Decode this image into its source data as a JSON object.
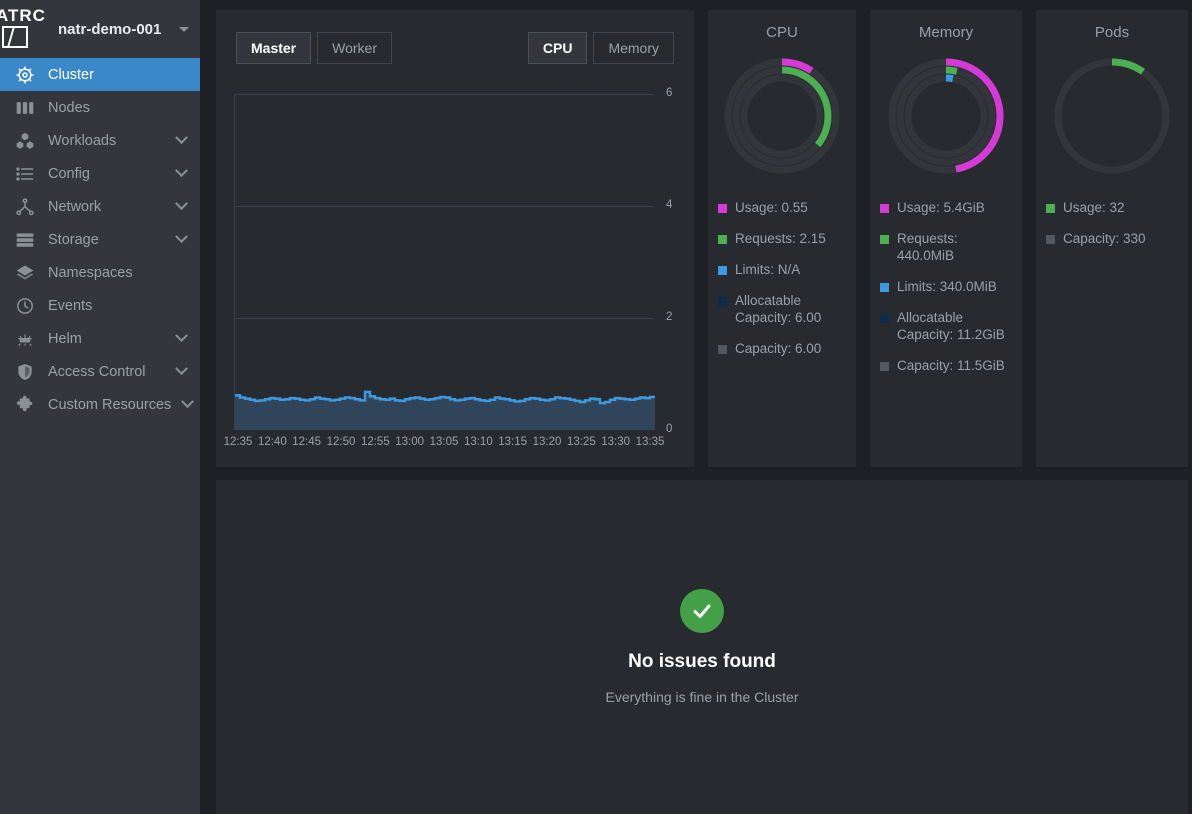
{
  "brand": {
    "logo_text": "ATRC",
    "logo_icon": "natrc-logo-icon",
    "cluster_name": "natr-demo-001"
  },
  "sidebar": {
    "items": [
      {
        "label": "Cluster",
        "icon": "helm-wheel-icon",
        "active": true,
        "expandable": false
      },
      {
        "label": "Nodes",
        "icon": "server-rack-icon",
        "active": false,
        "expandable": false
      },
      {
        "label": "Workloads",
        "icon": "cubes-icon",
        "active": false,
        "expandable": true
      },
      {
        "label": "Config",
        "icon": "list-icon",
        "active": false,
        "expandable": true
      },
      {
        "label": "Network",
        "icon": "network-nodes-icon",
        "active": false,
        "expandable": true
      },
      {
        "label": "Storage",
        "icon": "database-icon",
        "active": false,
        "expandable": true
      },
      {
        "label": "Namespaces",
        "icon": "layers-icon",
        "active": false,
        "expandable": false
      },
      {
        "label": "Events",
        "icon": "clock-icon",
        "active": false,
        "expandable": false
      },
      {
        "label": "Helm",
        "icon": "helm-icon",
        "active": false,
        "expandable": true
      },
      {
        "label": "Access Control",
        "icon": "shield-icon",
        "active": false,
        "expandable": true
      },
      {
        "label": "Custom Resources",
        "icon": "puzzle-icon",
        "active": false,
        "expandable": true
      }
    ]
  },
  "chart_panel": {
    "node_tabs": [
      {
        "label": "Master",
        "active": true
      },
      {
        "label": "Worker",
        "active": false
      }
    ],
    "metric_tabs": [
      {
        "label": "CPU",
        "active": true
      },
      {
        "label": "Memory",
        "active": false
      }
    ]
  },
  "chart_data": {
    "type": "area",
    "title": "",
    "xlabel": "",
    "ylabel": "",
    "ylim": [
      0,
      6
    ],
    "yticks": [
      0,
      2,
      4,
      6
    ],
    "grid": true,
    "legend": "none",
    "xticks": [
      "12:35",
      "12:40",
      "12:45",
      "12:50",
      "12:55",
      "13:00",
      "13:05",
      "13:10",
      "13:15",
      "13:20",
      "13:25",
      "13:30",
      "13:35"
    ],
    "series": [
      {
        "name": "CPU usage",
        "color": "#3b9ae1",
        "fill": "#31455a",
        "values": [
          0.62,
          0.58,
          0.56,
          0.54,
          0.52,
          0.53,
          0.55,
          0.57,
          0.56,
          0.54,
          0.55,
          0.57,
          0.56,
          0.54,
          0.53,
          0.55,
          0.58,
          0.56,
          0.55,
          0.53,
          0.54,
          0.56,
          0.58,
          0.57,
          0.55,
          0.53,
          0.68,
          0.6,
          0.57,
          0.55,
          0.54,
          0.56,
          0.53,
          0.52,
          0.55,
          0.57,
          0.58,
          0.56,
          0.54,
          0.55,
          0.57,
          0.59,
          0.58,
          0.55,
          0.53,
          0.54,
          0.56,
          0.57,
          0.55,
          0.53,
          0.52,
          0.54,
          0.58,
          0.56,
          0.55,
          0.53,
          0.51,
          0.52,
          0.55,
          0.57,
          0.56,
          0.54,
          0.53,
          0.55,
          0.58,
          0.57,
          0.56,
          0.54,
          0.52,
          0.5,
          0.53,
          0.56,
          0.55,
          0.48,
          0.5,
          0.54,
          0.57,
          0.56,
          0.55,
          0.54,
          0.56,
          0.58,
          0.57,
          0.59
        ]
      }
    ]
  },
  "metrics": [
    {
      "title": "CPU",
      "rings": [
        {
          "name": "usage",
          "color": "#d63ad6",
          "fraction": 0.092
        },
        {
          "name": "requests",
          "color": "#4caf50",
          "fraction": 0.358
        },
        {
          "name": "limits",
          "color": "#3b9ae1",
          "fraction": 0.0
        }
      ],
      "legend": [
        {
          "label": "Usage: 0.55",
          "color": "#d63ad6"
        },
        {
          "label": "Requests: 2.15",
          "color": "#4caf50"
        },
        {
          "label": "Limits: N/A",
          "color": "#3b9ae1"
        },
        {
          "label": "Allocatable Capacity: 6.00",
          "color": "#0d2b4a"
        },
        {
          "label": "Capacity: 6.00",
          "color": "#53585e"
        }
      ]
    },
    {
      "title": "Memory",
      "rings": [
        {
          "name": "usage",
          "color": "#d63ad6",
          "fraction": 0.47
        },
        {
          "name": "requests",
          "color": "#4caf50",
          "fraction": 0.038
        },
        {
          "name": "limits",
          "color": "#3b9ae1",
          "fraction": 0.029
        }
      ],
      "legend": [
        {
          "label": "Usage: 5.4GiB",
          "color": "#d63ad6"
        },
        {
          "label": "Requests: 440.0MiB",
          "color": "#4caf50"
        },
        {
          "label": "Limits: 340.0MiB",
          "color": "#3b9ae1"
        },
        {
          "label": "Allocatable Capacity: 11.2GiB",
          "color": "#0d2b4a"
        },
        {
          "label": "Capacity: 11.5GiB",
          "color": "#53585e"
        }
      ]
    },
    {
      "title": "Pods",
      "rings": [
        {
          "name": "usage",
          "color": "#4caf50",
          "fraction": 0.097
        }
      ],
      "legend": [
        {
          "label": "Usage: 32",
          "color": "#4caf50"
        },
        {
          "label": "Capacity: 330",
          "color": "#53585e"
        }
      ]
    }
  ],
  "issues": {
    "icon": "check-circle-icon",
    "title": "No issues found",
    "subtitle": "Everything is fine in the Cluster"
  },
  "colors": {
    "accent": "#3b88c9",
    "usage": "#d63ad6",
    "requests": "#4caf50",
    "limits": "#3b9ae1",
    "allocatable": "#0d2b4a",
    "capacity": "#53585e",
    "ok": "#43a047",
    "panel": "#272b30",
    "background": "#1d2125",
    "sidebar": "#33373d"
  }
}
